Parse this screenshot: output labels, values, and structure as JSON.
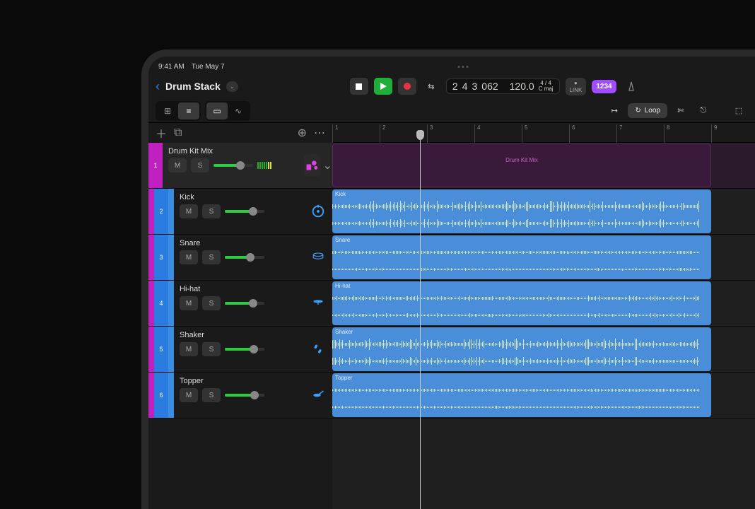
{
  "status": {
    "time": "9:41 AM",
    "date": "Tue May 7"
  },
  "header": {
    "title": "Drum Stack",
    "transport": {
      "bars": "2",
      "beats": "4",
      "division": "3",
      "ticks": "062",
      "tempo": "120.0",
      "signature": "4 / 4",
      "key": "C maj",
      "link": "LINK",
      "count_in": "1234"
    }
  },
  "toolbar": {
    "loop_label": "Loop"
  },
  "ruler_markers": [
    "1",
    "2",
    "3",
    "4",
    "5",
    "6",
    "7",
    "8",
    "9"
  ],
  "tracks": [
    {
      "num": "1",
      "name": "Drum Kit Mix",
      "mute": "M",
      "solo": "S",
      "parent": true,
      "vol": 65,
      "hasChevron": true,
      "iconColor": "#e040e0"
    },
    {
      "num": "2",
      "name": "Kick",
      "mute": "M",
      "solo": "S",
      "parent": false,
      "vol": 68,
      "iconColor": "#3aa0ff"
    },
    {
      "num": "3",
      "name": "Snare",
      "mute": "M",
      "solo": "S",
      "parent": false,
      "vol": 62,
      "iconColor": "#3aa0ff"
    },
    {
      "num": "4",
      "name": "Hi-hat",
      "mute": "M",
      "solo": "S",
      "parent": false,
      "vol": 68,
      "iconColor": "#3aa0ff"
    },
    {
      "num": "5",
      "name": "Shaker",
      "mute": "M",
      "solo": "S",
      "parent": false,
      "vol": 70,
      "iconColor": "#3aa0ff"
    },
    {
      "num": "6",
      "name": "Topper",
      "mute": "M",
      "solo": "S",
      "parent": false,
      "vol": 72,
      "iconColor": "#3aa0ff"
    }
  ],
  "regions": {
    "parent_label": "Drum Kit Mix",
    "child_labels": [
      "Kick",
      "Snare",
      "Hi-hat",
      "Shaker",
      "Topper"
    ]
  },
  "playhead_bar": 3
}
